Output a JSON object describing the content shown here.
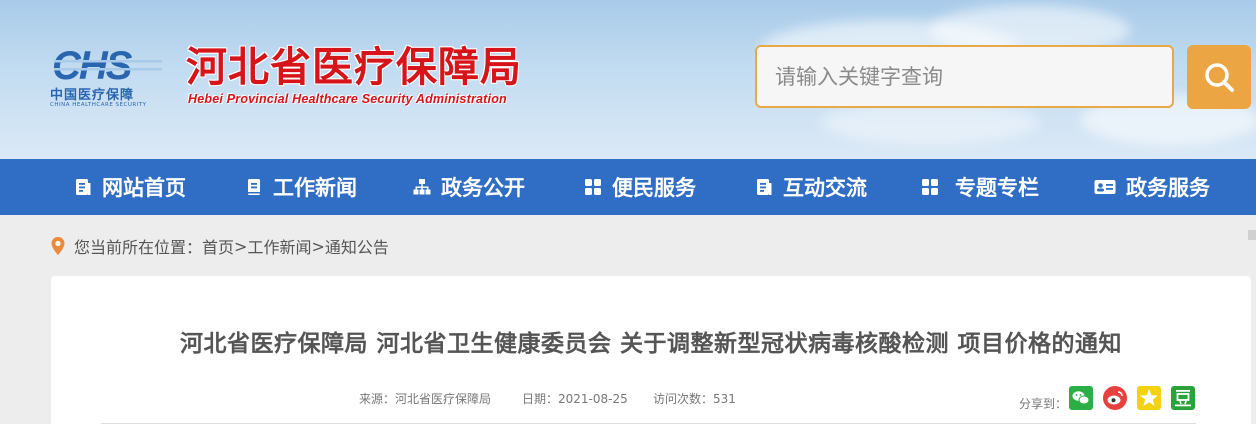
{
  "header": {
    "logo_cn": "中国医疗保障",
    "logo_en": "CHINA HEALTHCARE SECURITY",
    "site_title": "河北省医疗保障局",
    "site_subtitle": "Hebei Provincial Healthcare Security Administration",
    "search": {
      "placeholder": "请输入关键字查询"
    }
  },
  "nav": {
    "items": [
      {
        "label": "网站首页",
        "icon": "document-icon"
      },
      {
        "label": "工作新闻",
        "icon": "bookmark-icon"
      },
      {
        "label": "政务公开",
        "icon": "org-chart-icon"
      },
      {
        "label": "便民服务",
        "icon": "grid-icon"
      },
      {
        "label": "互动交流",
        "icon": "document-icon"
      },
      {
        "label": "专题专栏",
        "icon": "grid-icon"
      },
      {
        "label": "政务服务",
        "icon": "id-card-icon"
      }
    ]
  },
  "breadcrumb": {
    "prefix": "您当前所在位置：",
    "items": [
      "首页",
      "工作新闻",
      "通知公告"
    ],
    "separator": ">"
  },
  "article": {
    "title": "河北省医疗保障局 河北省卫生健康委员会 关于调整新型冠状病毒核酸检测 项目价格的通知",
    "source_label": "来源：",
    "source": "河北省医疗保障局",
    "date_label": "日期：",
    "date": "2021-08-25",
    "views_label": "访问次数：",
    "views": "531",
    "share_label": "分享到："
  },
  "colors": {
    "nav_bg": "#2f6ec4",
    "accent_orange": "#eca543",
    "title_red": "#d7141a",
    "wechat_green": "#2aae45",
    "weibo_red": "#e6413e",
    "qzone_yellow": "#f4d20f",
    "douban_green": "#2aa33a"
  }
}
